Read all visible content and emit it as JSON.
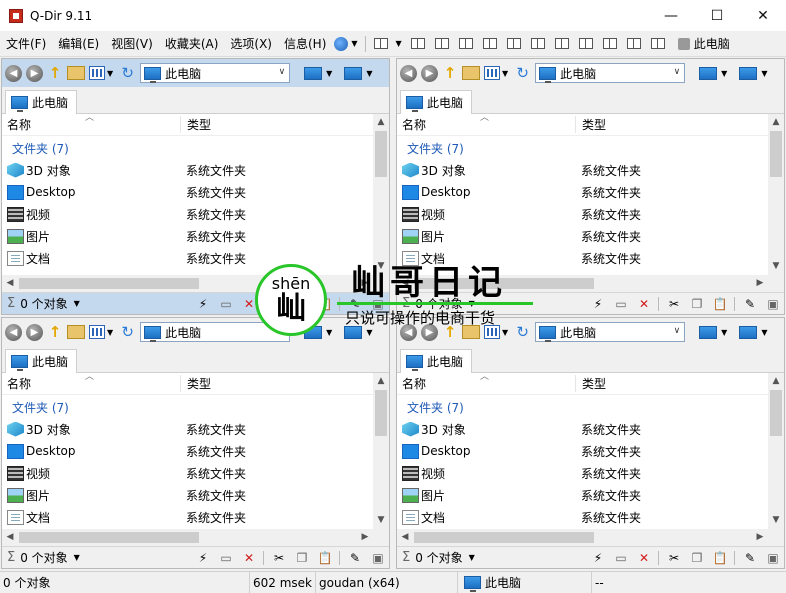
{
  "window": {
    "title": "Q-Dir 9.11",
    "controls": [
      "—",
      "☐",
      "✕"
    ]
  },
  "menu": {
    "items": [
      "文件(F)",
      "编辑(E)",
      "视图(V)",
      "收藏夹(A)",
      "选项(X)",
      "信息(H)"
    ],
    "right_label": "此电脑"
  },
  "pane": {
    "address": "此电脑",
    "tab": "此电脑",
    "col_name": "名称",
    "col_type": "类型",
    "group": "文件夹 (7)",
    "files": [
      {
        "name": "3D 对象",
        "type": "系统文件夹",
        "icon": "3d-objects-icon"
      },
      {
        "name": "Desktop",
        "type": "系统文件夹",
        "icon": "desktop-icon"
      },
      {
        "name": "视频",
        "type": "系统文件夹",
        "icon": "video-icon"
      },
      {
        "name": "图片",
        "type": "系统文件夹",
        "icon": "pictures-icon"
      },
      {
        "name": "文档",
        "type": "系统文件夹",
        "icon": "documents-icon"
      }
    ],
    "status": "0 个对象"
  },
  "statusbar": {
    "objects": "0 个对象",
    "time": "602 msek",
    "user": "goudan (x64)",
    "location": "此电脑",
    "extra": "--"
  },
  "watermark": {
    "pinyin": "shēn",
    "char": "屾",
    "title": "屾哥日记",
    "subtitle": "只说可操作的电商干货"
  },
  "colors": {
    "active_toolbar": "#c4d8ee",
    "group_blue": "#1e5ab6",
    "watermark_green": "#28c628"
  }
}
